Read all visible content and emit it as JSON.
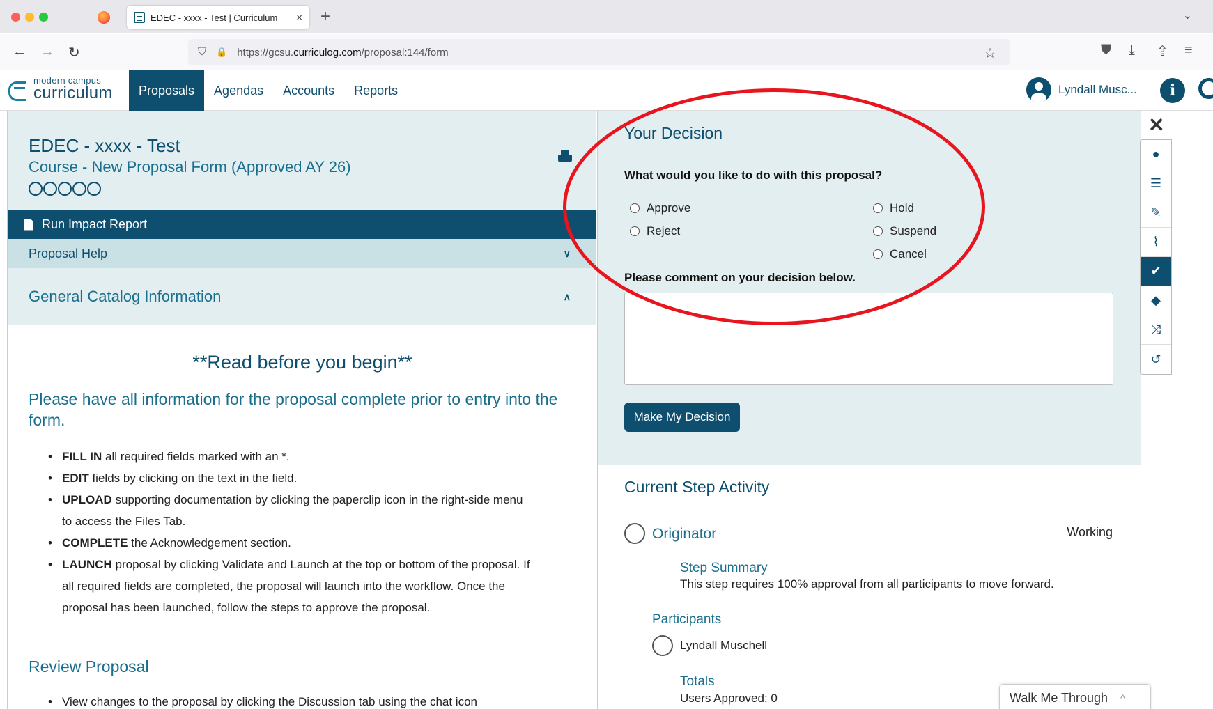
{
  "browser": {
    "tab_title": "EDEC - xxxx - Test | Curriculum",
    "tab_close": "×",
    "new_tab": "+",
    "url_prefix": "https://gcsu.",
    "url_domain": "curriculog.com",
    "url_path": "/proposal:144/form",
    "icons": {
      "back": "←",
      "forward": "→",
      "reload": "↻",
      "shield": "⛉",
      "lock": "🔒",
      "star": "☆",
      "pocket": "⛊",
      "download": "⤓",
      "share": "⇪",
      "menu": "≡",
      "tab_list": "⌄"
    }
  },
  "app": {
    "logo_small": "modern campus",
    "logo_big": "curriculum",
    "menu": [
      "Proposals",
      "Agendas",
      "Accounts",
      "Reports"
    ],
    "active_menu": "Proposals",
    "user_name": "Lyndall Musc...",
    "info_label": "i"
  },
  "left": {
    "title": "EDEC - xxxx - Test",
    "subtitle": "Course - New Proposal Form (Approved AY 26)",
    "run_impact_report": "Run Impact Report",
    "proposal_help": "Proposal Help",
    "section_title": "General Catalog Information",
    "read_title": "**Read before you begin**",
    "please_text": "Please have all information for the proposal complete prior to entry into the form.",
    "bullets": [
      {
        "bold": "FILL IN",
        "text": " all required fields marked with an *."
      },
      {
        "bold": "EDIT",
        "text": " fields by clicking on the text in the field."
      },
      {
        "bold": "UPLOAD",
        "text": " supporting documentation by clicking the paperclip icon in the right-side menu to access the Files Tab."
      },
      {
        "bold": "COMPLETE",
        "text": " the Acknowledgement section."
      },
      {
        "bold": "LAUNCH",
        "text": " proposal by clicking Validate and Launch at the top or bottom of the proposal.  If all required fields are completed, the proposal will launch into the workflow. Once the proposal has been launched, follow the steps to approve the proposal."
      }
    ],
    "review_title": "Review Proposal",
    "review_bullets": [
      "View changes to the proposal by clicking the Discussion tab using the chat icon"
    ]
  },
  "decision": {
    "title": "Your Decision",
    "question": "What would you like to do with this proposal?",
    "options": [
      "Approve",
      "Hold",
      "Reject",
      "Suspend",
      "Cancel"
    ],
    "comment_label": "Please comment on your decision below.",
    "comment_value": "",
    "submit_label": "Make My Decision"
  },
  "activity": {
    "title": "Current Step Activity",
    "step_name": "Originator",
    "step_status": "Working",
    "summary_title": "Step Summary",
    "summary_text": "This step requires 100% approval from all participants to move forward.",
    "participants_title": "Participants",
    "participant": "Lyndall Muschell",
    "totals_title": "Totals",
    "totals_text": "Users Approved:  0"
  },
  "rail": {
    "close": "✕",
    "items": [
      {
        "icon": "discussion-icon",
        "glyph": "●"
      },
      {
        "icon": "list-icon",
        "glyph": "☰"
      },
      {
        "icon": "edit-icon",
        "glyph": "✎"
      },
      {
        "icon": "paperclip-icon",
        "glyph": "⌇"
      },
      {
        "icon": "check-icon",
        "glyph": "✔"
      },
      {
        "icon": "route-icon",
        "glyph": "◆"
      },
      {
        "icon": "shuffle-icon",
        "glyph": "⤨"
      },
      {
        "icon": "history-icon",
        "glyph": "↺"
      }
    ]
  },
  "walk_me": {
    "label": "Walk Me Through",
    "chevron": "^"
  },
  "colors": {
    "brand": "#0e4e6e",
    "panel": "#e3eef0",
    "annotation": "#e8141e"
  }
}
